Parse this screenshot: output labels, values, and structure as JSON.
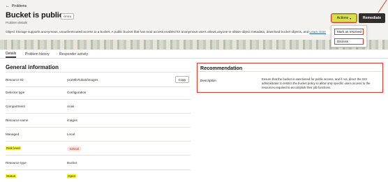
{
  "header": {
    "back_label": "Problems",
    "title": "Bucket is public",
    "status_badge": "OPEN",
    "subtitle": "Problem details",
    "description": "Object Storage supports anonymous, unauthenticated access to a bucket. A public bucket that has read access enabled for anonymous users allows anyone to obtain object metadata, download bucket objects, and",
    "learn_more": "Learn more",
    "actions_label": "Actions",
    "remediate_label": "Remediate"
  },
  "actions_menu": {
    "items": [
      "Mark as resolved",
      "Dismiss"
    ]
  },
  "tabs": [
    "Details",
    "Problem history",
    "Responder activity"
  ],
  "general": {
    "title": "General information",
    "copy_label": "Copy",
    "rows": [
      {
        "label": "Resource ID",
        "value": "yxo00b7iuko0/images"
      },
      {
        "label": "Detector type",
        "value": "Configuration"
      },
      {
        "label": "Compartment",
        "value": "Anas"
      },
      {
        "label": "Resource name",
        "value": "images"
      },
      {
        "label": "Managed",
        "value": "Local"
      },
      {
        "label": "Risk level",
        "value": "Critical"
      },
      {
        "label": "Resource type",
        "value": "Bucket"
      },
      {
        "label": "Status",
        "value": "Open"
      }
    ]
  },
  "recommendation": {
    "title": "Recommendation",
    "label": "Description",
    "text": "Ensure that the bucket is sanctioned for public access, and if not, direct the OCI administrator to restrict the bucket policy to allow only specific users access to the resources required to accomplish their job functions."
  },
  "colors": {
    "actions_bg": "#d6e04a",
    "remediate_bg": "#312d2a",
    "annotation": "#e0392f",
    "highlight": "#f7f23c",
    "critical": "#9b2a22"
  }
}
